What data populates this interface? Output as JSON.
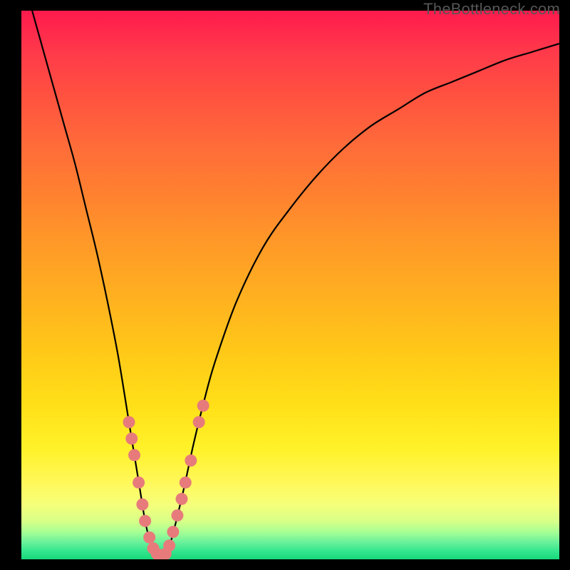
{
  "watermark": "TheBottleneck.com",
  "colors": {
    "curve": "#000000",
    "marker_fill": "#e77b7b",
    "marker_stroke": "#cc5a5a",
    "gradient_top": "#ff1a4d",
    "gradient_bottom": "#18d87a"
  },
  "chart_data": {
    "type": "line",
    "title": "",
    "xlabel": "",
    "ylabel": "",
    "xlim": [
      0,
      100
    ],
    "ylim": [
      0,
      100
    ],
    "grid": false,
    "series": [
      {
        "name": "bottleneck-curve",
        "x": [
          2,
          4,
          6,
          8,
          10,
          12,
          14,
          16,
          18,
          20,
          21,
          22,
          23,
          24,
          25,
          26,
          27,
          28,
          30,
          32,
          34,
          36,
          40,
          45,
          50,
          55,
          60,
          65,
          70,
          75,
          80,
          85,
          90,
          95,
          100
        ],
        "y": [
          100,
          93,
          86,
          79,
          72,
          64,
          56,
          47,
          37,
          25,
          19,
          13,
          7,
          3,
          1,
          0,
          1,
          4,
          12,
          21,
          29,
          36,
          47,
          57,
          64,
          70,
          75,
          79,
          82,
          85,
          87,
          89,
          91,
          92.5,
          94
        ]
      }
    ],
    "markers": [
      {
        "x": 20.0,
        "y": 25
      },
      {
        "x": 20.5,
        "y": 22
      },
      {
        "x": 21.0,
        "y": 19
      },
      {
        "x": 21.8,
        "y": 14
      },
      {
        "x": 22.5,
        "y": 10
      },
      {
        "x": 23.0,
        "y": 7
      },
      {
        "x": 23.8,
        "y": 4
      },
      {
        "x": 24.5,
        "y": 2
      },
      {
        "x": 25.2,
        "y": 1
      },
      {
        "x": 26.0,
        "y": 0.5
      },
      {
        "x": 26.8,
        "y": 1
      },
      {
        "x": 27.5,
        "y": 2.5
      },
      {
        "x": 28.2,
        "y": 5
      },
      {
        "x": 29.0,
        "y": 8
      },
      {
        "x": 29.8,
        "y": 11
      },
      {
        "x": 30.5,
        "y": 14
      },
      {
        "x": 31.5,
        "y": 18
      },
      {
        "x": 33.0,
        "y": 25
      },
      {
        "x": 33.8,
        "y": 28
      }
    ]
  }
}
